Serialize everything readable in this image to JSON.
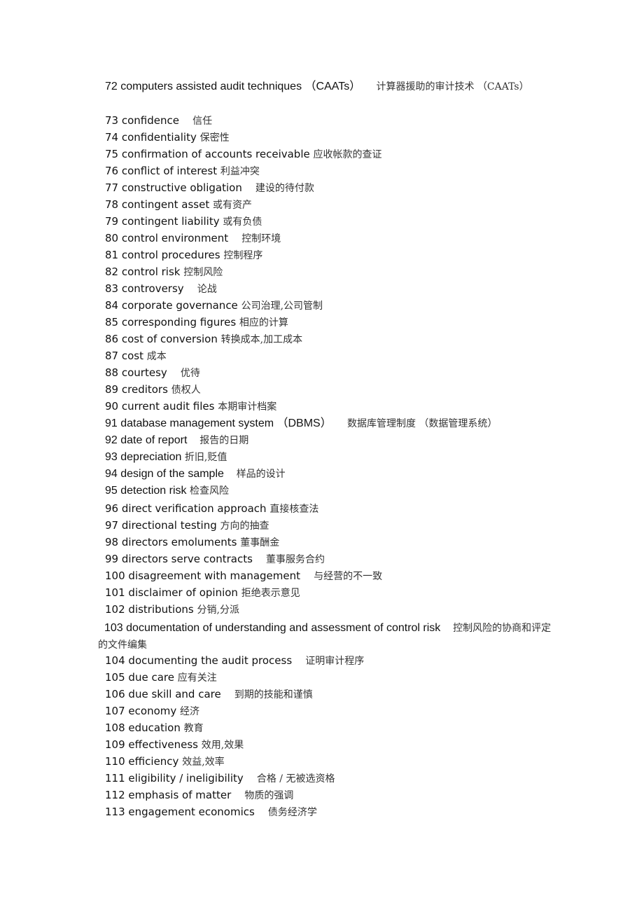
{
  "document": {
    "entries": [
      {
        "num": "72",
        "en": "computers assisted audit techniques （CAATs）",
        "zh": "计算器援助的审计技术 （CAATs）"
      },
      {
        "num": "73",
        "en": "confidence",
        "zh": "信任"
      },
      {
        "num": "74",
        "en": "confidentiality",
        "zh": "保密性"
      },
      {
        "num": "75",
        "en": "confirmation of accounts receivable",
        "zh": "应收帐款的查证"
      },
      {
        "num": "76",
        "en": "conflict of interest",
        "zh": "利益冲突"
      },
      {
        "num": "77",
        "en": "constructive obligation",
        "zh": "建设的待付款"
      },
      {
        "num": "78",
        "en": "contingent asset",
        "zh": "或有资产"
      },
      {
        "num": "79",
        "en": "contingent liability",
        "zh": "或有负债"
      },
      {
        "num": "80",
        "en": "control environment",
        "zh": "控制环境"
      },
      {
        "num": "81",
        "en": "control procedures",
        "zh": "控制程序"
      },
      {
        "num": "82",
        "en": "control risk",
        "zh": "控制风险"
      },
      {
        "num": "83",
        "en": "controversy",
        "zh": "论战"
      },
      {
        "num": "84",
        "en": "corporate governance",
        "zh": "公司治理,公司管制"
      },
      {
        "num": "85",
        "en": "corresponding figures",
        "zh": "相应的计算"
      },
      {
        "num": "86",
        "en": "cost of conversion",
        "zh": "转换成本,加工成本"
      },
      {
        "num": "87",
        "en": "cost",
        "zh": "成本"
      },
      {
        "num": "88",
        "en": "courtesy",
        "zh": "优待"
      },
      {
        "num": "89",
        "en": "creditors",
        "zh": "债权人"
      },
      {
        "num": "90",
        "en": "current audit files",
        "zh": "本期审计档案"
      },
      {
        "num": "91",
        "en": "database management system （DBMS）",
        "zh": "数据库管理制度 （数据管理系统）"
      },
      {
        "num": "92",
        "en": "date of report",
        "zh": "报告的日期"
      },
      {
        "num": "93",
        "en": "depreciation",
        "zh": "折旧,贬值"
      },
      {
        "num": "94",
        "en": "design of the sample",
        "zh": "样品的设计"
      },
      {
        "num": "95",
        "en": "detection risk",
        "zh": "检查风险"
      },
      {
        "num": "96",
        "en": "direct verification approach",
        "zh": "直接核查法"
      },
      {
        "num": "97",
        "en": "directional testing",
        "zh": "方向的抽查"
      },
      {
        "num": "98",
        "en": "directors emoluments",
        "zh": "董事酬金"
      },
      {
        "num": "99",
        "en": "directors serve contracts",
        "zh": "董事服务合约"
      },
      {
        "num": "100",
        "en": "disagreement with management",
        "zh": "与经营的不一致"
      },
      {
        "num": "101",
        "en": "disclaimer of opinion",
        "zh": "拒绝表示意见"
      },
      {
        "num": "102",
        "en": "distributions",
        "zh": "分销,分派"
      },
      {
        "num": "103",
        "en": "documentation of understanding and assessment of control risk",
        "zh": "控制风险的协商和评定的文件编集"
      },
      {
        "num": "104",
        "en": "documenting the audit process",
        "zh": "证明审计程序"
      },
      {
        "num": "105",
        "en": "due care",
        "zh": "应有关注"
      },
      {
        "num": "106",
        "en": "due skill and care",
        "zh": "到期的技能和谨慎"
      },
      {
        "num": "107",
        "en": "economy",
        "zh": "经济"
      },
      {
        "num": "108",
        "en": "education",
        "zh": "教育"
      },
      {
        "num": "109",
        "en": "effectiveness",
        "zh": "效用,效果"
      },
      {
        "num": "110",
        "en": "efficiency",
        "zh": "效益,效率"
      },
      {
        "num": "111",
        "en": "eligibility / ineligibility",
        "zh": "合格 / 无被选资格"
      },
      {
        "num": "112",
        "en": "emphasis of matter",
        "zh": "物质的强调"
      },
      {
        "num": "113",
        "en": "engagement economics",
        "zh": "债务经济学"
      }
    ]
  }
}
